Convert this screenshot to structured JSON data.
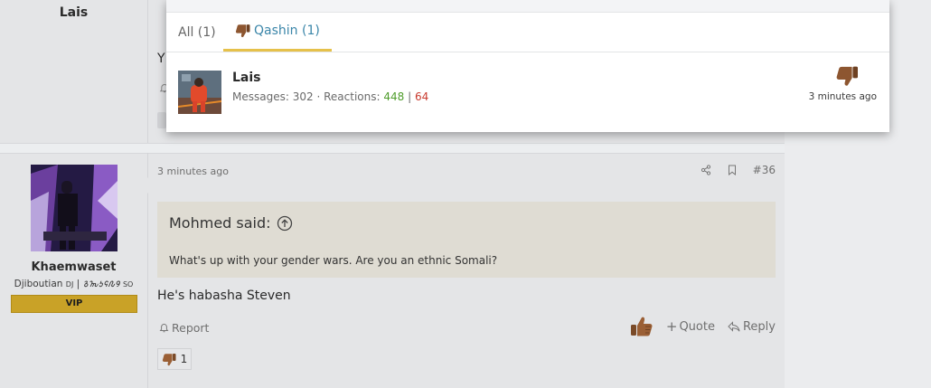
{
  "previous_post": {
    "username": "Lais",
    "text_fragment": "Y",
    "react_icon": "thumbs-down-icon"
  },
  "post": {
    "time": "3 minutes ago",
    "post_number": "#36",
    "user": {
      "name": "Khaemwaset",
      "title_prefix": "Djiboutian",
      "title_flag1": "DJ",
      "title_sep": "|",
      "title_script": "𐒈𐒝𐒑𐒛𐒐𐒘",
      "title_flag2": "SO",
      "badge": "VIP"
    },
    "quote": {
      "author_line": "Mohmed said:",
      "text": "What's up with your gender wars. Are you an ethnic Somali?"
    },
    "text": "He's habasha Steven",
    "report_label": "Report",
    "quote_label": "Quote",
    "reply_label": "Reply",
    "reaction_count": "1",
    "icons": [
      "share-icon",
      "bookmark-icon",
      "thumbs-up-icon",
      "thumbs-down-icon",
      "bell-icon"
    ]
  },
  "reactions_modal": {
    "tabs": [
      {
        "label": "All (1)",
        "active": false
      },
      {
        "label": "Qashin (1)",
        "active": true
      }
    ],
    "rows": [
      {
        "name": "Lais",
        "messages_label": "Messages:",
        "messages": "302",
        "reactions_label": "Reactions:",
        "reactions_positive": "448",
        "reactions_negative": "64",
        "time": "3 minutes ago"
      }
    ],
    "accent_tab_color": "#e6c14a",
    "link_color": "#3b86a9"
  }
}
